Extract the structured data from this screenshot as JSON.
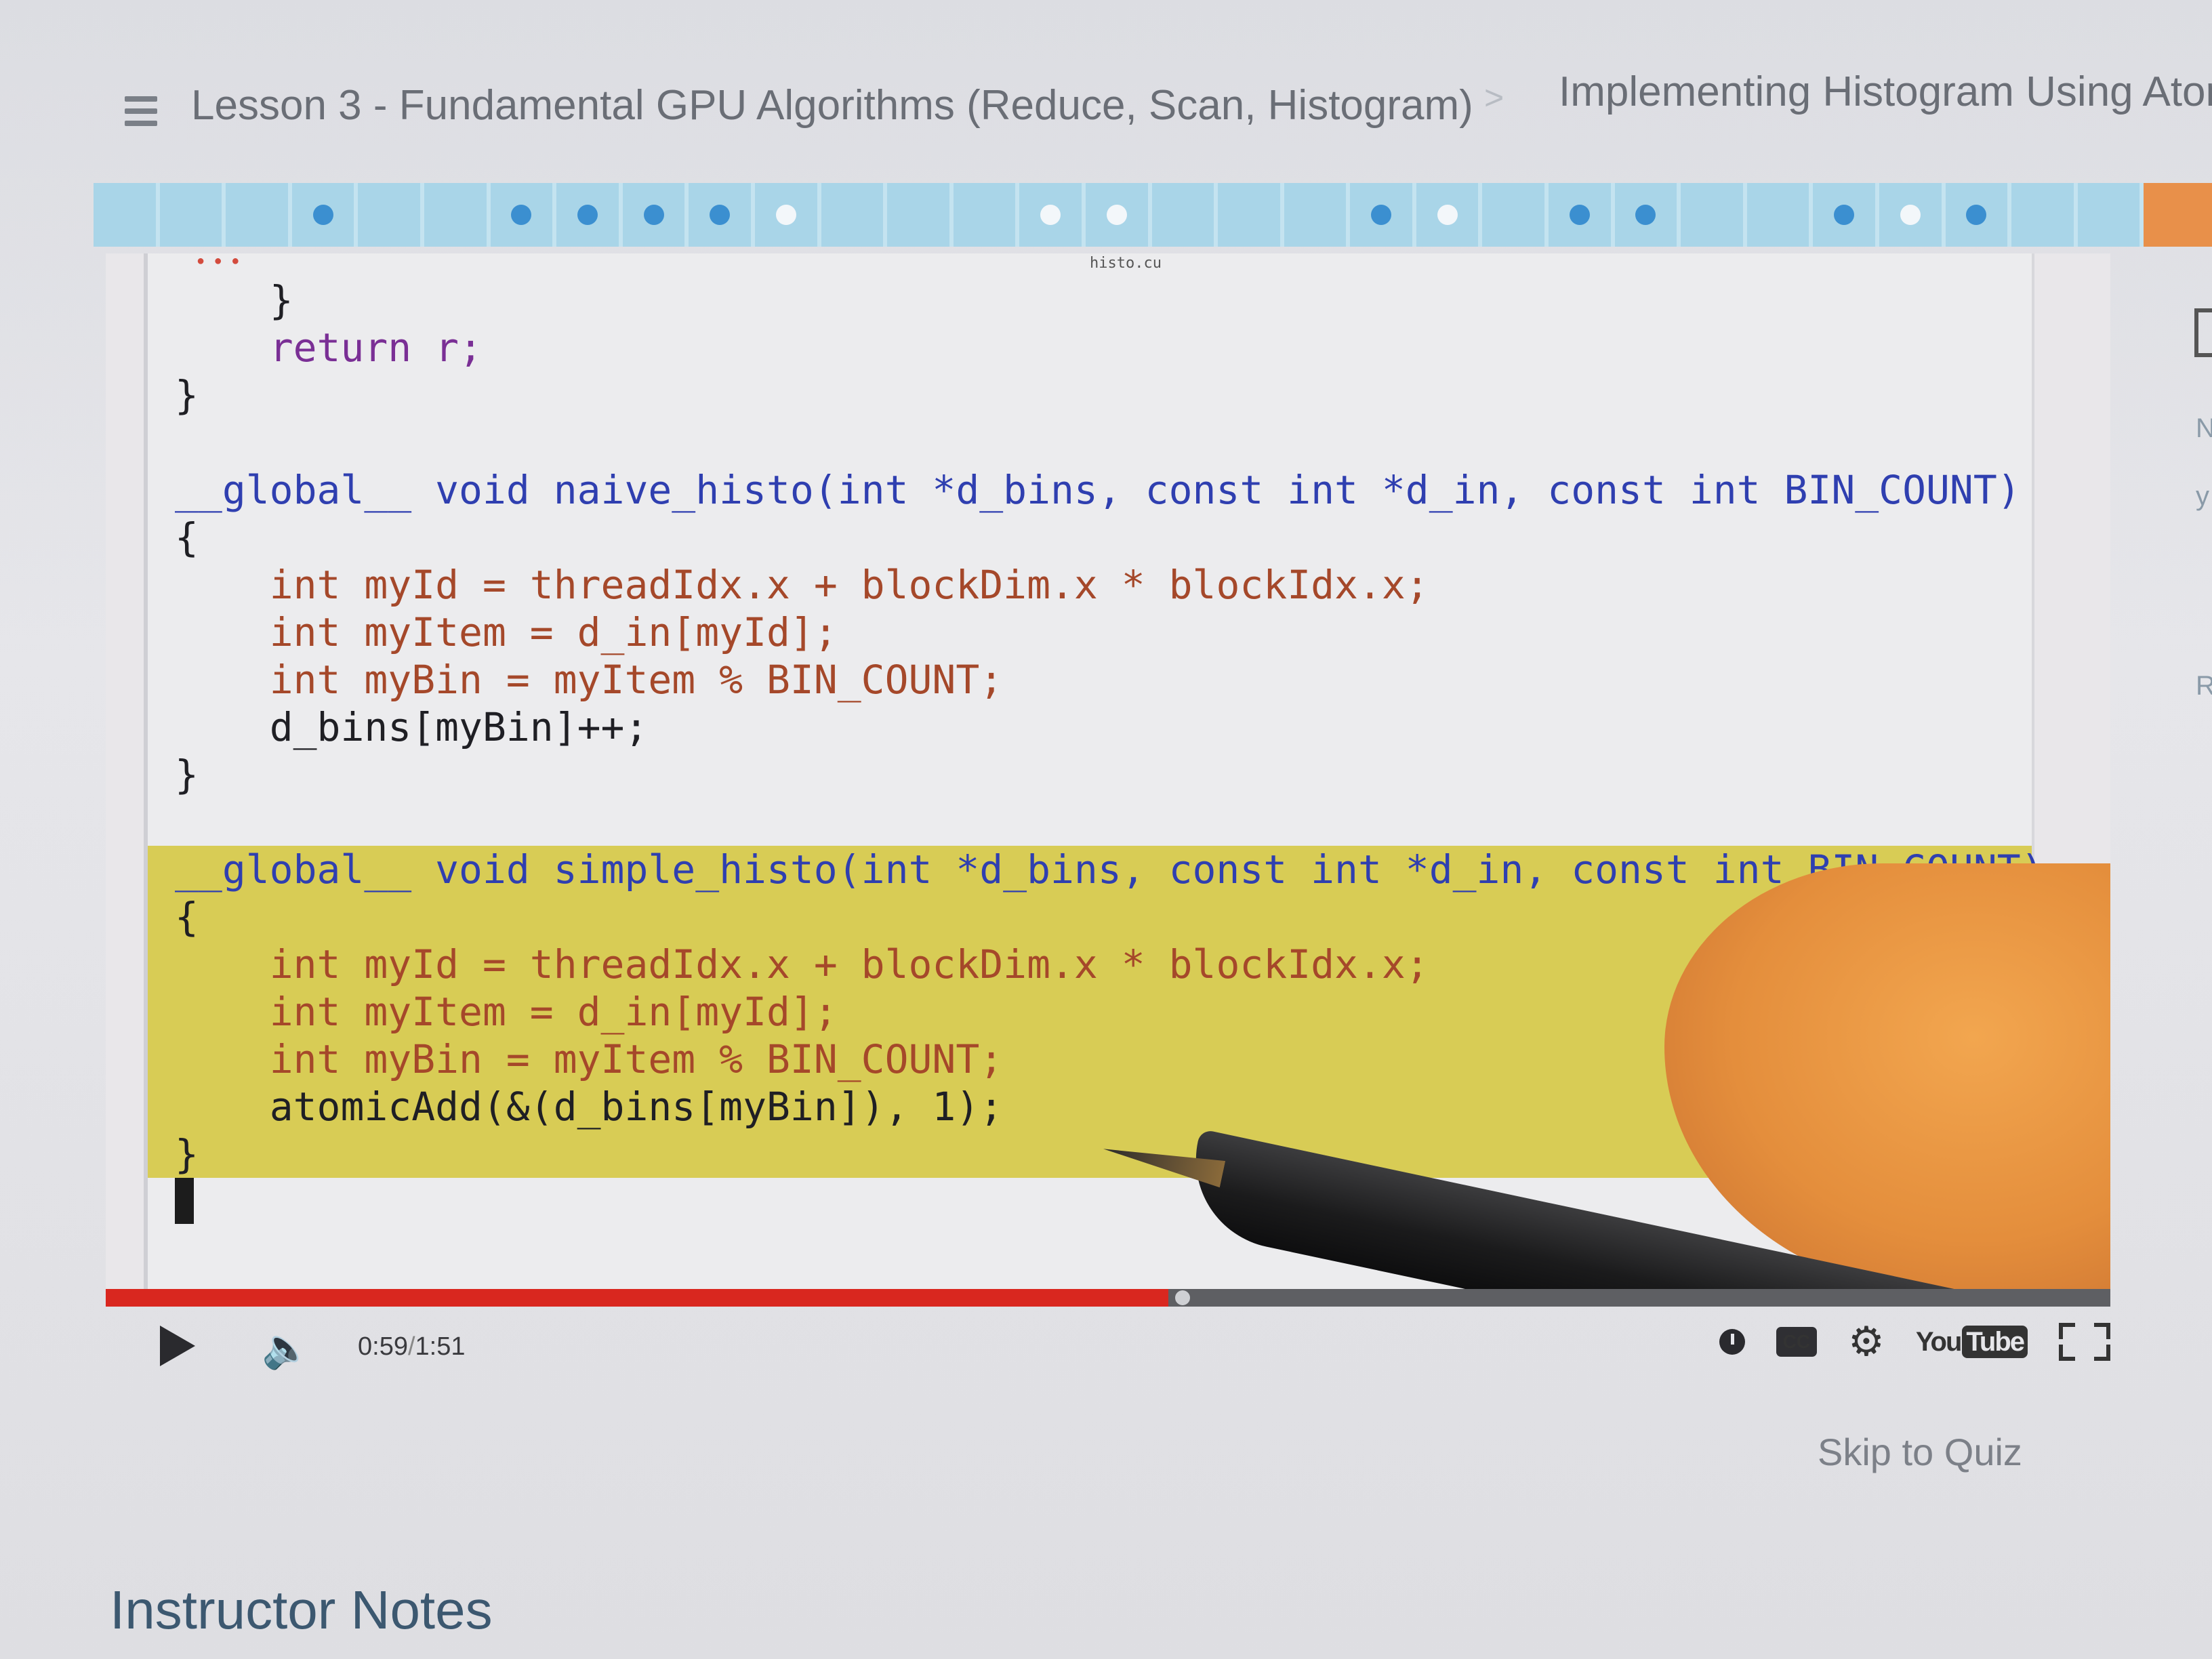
{
  "breadcrumb": {
    "lesson": "Lesson 3 - Fundamental GPU Algorithms (Reduce, Scan, Histogram)",
    "separator": ">",
    "current": "Implementing Histogram Using Ator"
  },
  "progress_strip": {
    "segments": [
      "empty",
      "empty",
      "empty",
      "dot",
      "empty",
      "empty",
      "dot",
      "dot",
      "dot",
      "dot",
      "white",
      "empty",
      "empty",
      "empty",
      "white",
      "white",
      "empty",
      "empty",
      "empty",
      "dot",
      "white",
      "empty",
      "dot",
      "dot",
      "empty",
      "empty",
      "dot",
      "white",
      "dot",
      "empty",
      "empty",
      "orange"
    ]
  },
  "video": {
    "window_title": "histo.cu",
    "code_lines": [
      "}",
      "return r;",
      "}",
      "",
      "__global__ void naive_histo(int *d_bins, const int *d_in, const int BIN_COUNT)",
      "{",
      "int myId = threadIdx.x + blockDim.x * blockIdx.x;",
      "int myItem = d_in[myId];",
      "int myBin = myItem % BIN_COUNT;",
      "d_bins[myBin]++;",
      "}",
      "",
      "__global__ void simple_histo(int *d_bins, const int *d_in, const int BIN_COUNT)",
      "{",
      "int myId = threadIdx.x + blockDim.x * blockIdx.x;",
      "int myItem = d_in[myId];",
      "int myBin = myItem % BIN_COUNT;",
      "atomicAdd(&(d_bins[myBin]), 1);",
      "}"
    ],
    "playback_fraction": 0.53
  },
  "player": {
    "time_current": "0:59",
    "time_separator": "/",
    "time_total": "1:51",
    "youtube_label": "You",
    "youtube_badge": "Tube",
    "cc_label": "CC",
    "colors": {
      "played": "#d9271f",
      "buffer": "#5e5f63"
    }
  },
  "skip_to_quiz": "Skip to Quiz",
  "instructor_notes": "Instructor Notes",
  "side_fragments": [
    "N",
    "y",
    "R"
  ]
}
